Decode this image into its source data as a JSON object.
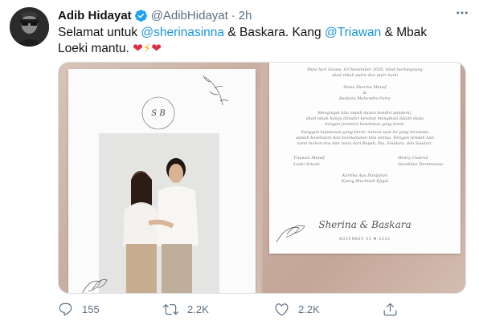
{
  "tweet": {
    "author": {
      "name": "Adib Hidayat",
      "handle": "@AdibHidayat",
      "separator": "·",
      "time": "2h",
      "avatar_icon": "avatar-photo"
    },
    "more_icon": "more-icon",
    "text": {
      "part1": "Selamat untuk ",
      "mention1": "@sherinasinna",
      "part2": " & Baskara. Kang ",
      "mention2": "@Triawan",
      "part3": " & Mbak Loeki mantu. ",
      "emoji": [
        "❤",
        "⚡",
        "❤"
      ]
    },
    "media": {
      "invitation": {
        "intro_line1": "Pada hari Selasa, 03 November 2020, telah berlangsung",
        "intro_line2": "akad nikah putra dan putri kami",
        "bride": "Siena Sherina Munaf",
        "amp": "&",
        "groom": "Baskara Mahendra Putra",
        "body_line1": "Mengingat kita masih dalam kondisi pandemi,",
        "body_line2": "akad nikah hanya dihadiri kerabat mengikuti dalam skala",
        "body_line3": "dengan protokol kesehatan yang ketat.",
        "body_line4": "Sungguh keputusan yang berat, namun saat ini yang terutama",
        "body_line5": "adalah kesehatan dan keselamatan kita semua. Dengan rendah hati",
        "body_line6": "kami mohon doa dan restu dari Bapak, Ibu, Saudara, dan Saudari.",
        "parent_l1": "Triawan Munaf",
        "parent_l2": "Loeki Artasti",
        "parent_r1": "Henry Chaerul",
        "parent_r2": "Gerakline Derminiana",
        "family_1": "Kartika Ayu Danijatun",
        "family_2": "Eyang Muchtadi Djajal",
        "script_names": "Sherina  &  Baskara",
        "date_line": "NOVEMBER 03 ♥ 2020"
      }
    },
    "actions": {
      "reply": {
        "icon": "reply-icon",
        "count": "155"
      },
      "retweet": {
        "icon": "retweet-icon",
        "count": "2.2K"
      },
      "like": {
        "icon": "like-icon",
        "count": "2.2K"
      },
      "share": {
        "icon": "share-icon"
      }
    },
    "colors": {
      "link": "#1b95e0",
      "secondary_text": "#5b7083",
      "verified": "#1da1f2",
      "heart": "#dd2e44",
      "bolt": "#f4b400"
    }
  }
}
